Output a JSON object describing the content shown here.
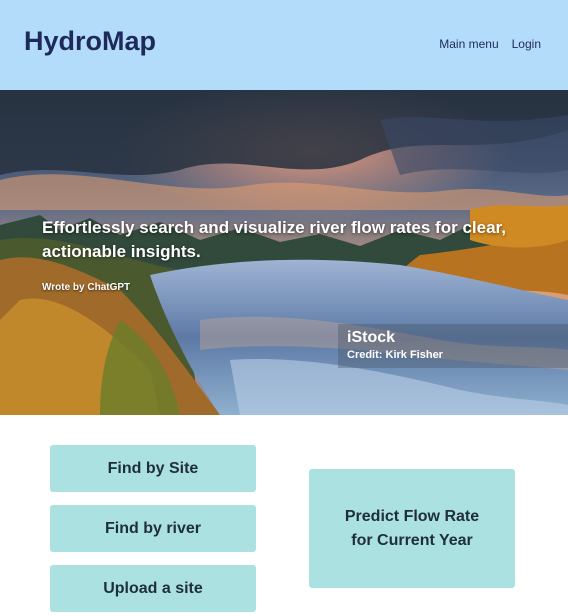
{
  "app": {
    "title": "HydroMap"
  },
  "nav": {
    "items": [
      "Main menu",
      "Login"
    ]
  },
  "hero": {
    "tagline": "Effortlessly search and visualize river flow rates for clear, actionable insights.",
    "attribution": "Wrote by ChatGPT",
    "stock_logo": "iStock",
    "stock_credit": "Credit: Kirk Fisher"
  },
  "actions": {
    "find_by_site": "Find by Site",
    "find_by_river": "Find by river",
    "upload_site": "Upload a site",
    "predict_flow_line1": "Predict Flow Rate",
    "predict_flow_line2": "for Current Year"
  },
  "colors": {
    "header_bg": "#b3dcfb",
    "brand_text": "#1d2a5a",
    "button_bg": "#abe1e1"
  }
}
